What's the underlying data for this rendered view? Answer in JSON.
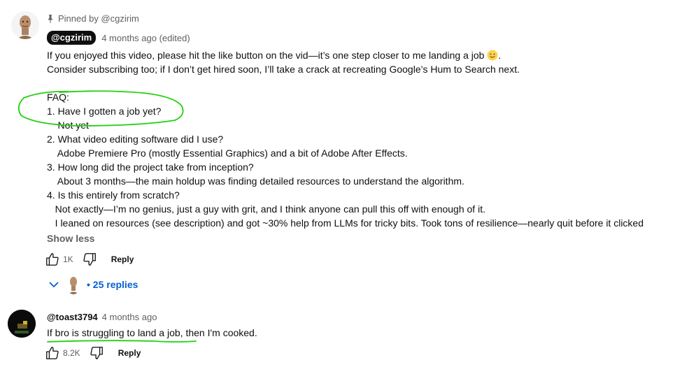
{
  "pinned_comment": {
    "pinned_label": "Pinned by @cgzirim",
    "author": "@cgzirim",
    "meta": "4 months ago (edited)",
    "lines": [
      "If you enjoyed this video, please hit the like button on the vid—it’s one step closer to me landing a job ",
      "Consider subscribing too; if I don’t get hired soon, I’ll take a crack at recreating Google’s Hum to Search next.",
      "",
      "FAQ:",
      "1. Have I gotten a job yet?",
      "    Not yet",
      "2. What video editing software did I use?",
      "    Adobe Premiere Pro (mostly Essential Graphics) and a bit of Adobe After Effects.",
      "3. How long did the project take from inception?",
      "    About 3 months—the main holdup was finding detailed resources to understand the algorithm.",
      "4. Is this entirely from scratch?",
      "   Not exactly—I’m no genius, just a guy with grit, and I think anyone can pull this off with enough of it.",
      "   I leaned on resources (see description) and got ~30% help from LLMs for tricky bits. Took tons of resilience—nearly quit before it clicked"
    ],
    "line1_suffix": ".",
    "emoji": "slightly-smiling-face-icon",
    "show_less": "Show less",
    "like_count": "1K",
    "reply_label": "Reply",
    "replies_label": "• 25 replies"
  },
  "second_comment": {
    "author": "@toast3794",
    "meta": "4 months ago",
    "text": "If bro is struggling to land a job, then I'm cooked.",
    "like_count": "8.2K",
    "reply_label": "Reply"
  },
  "colors": {
    "link_blue": "#065fd4",
    "annotation_green": "#22d10f",
    "secondary_text": "#606060"
  }
}
